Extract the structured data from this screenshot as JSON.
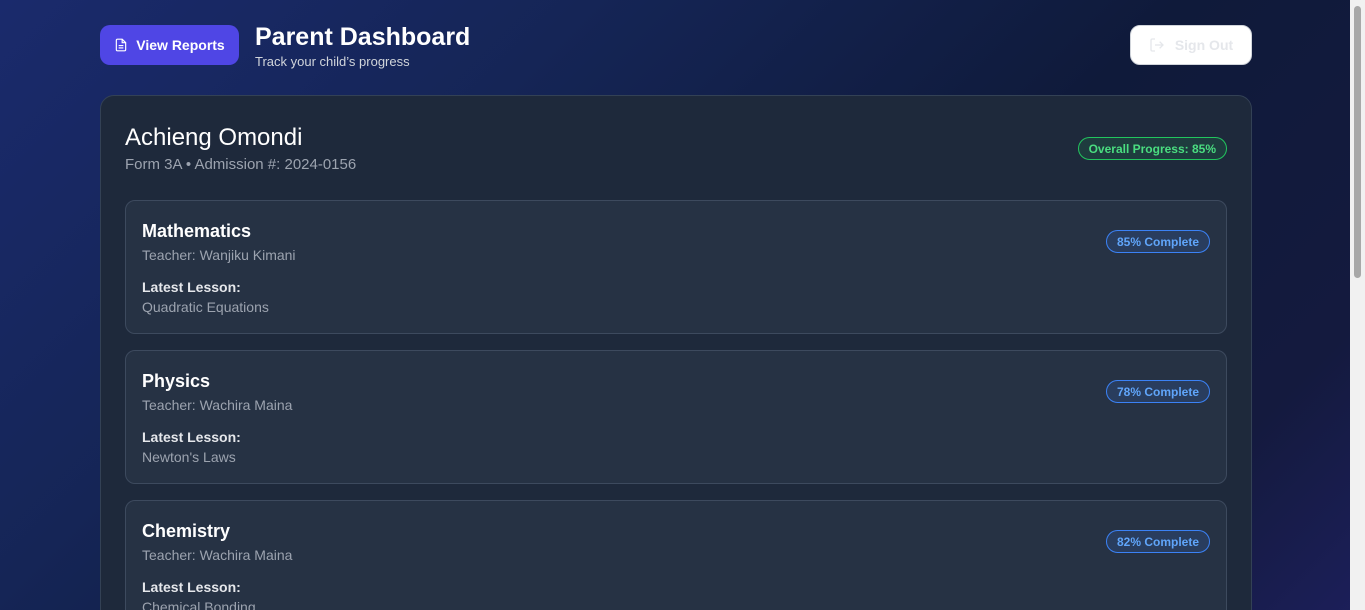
{
  "header": {
    "reports_label": "View Reports",
    "title": "Parent Dashboard",
    "subtitle": "Track your child’s progress",
    "signout_label": "Sign Out"
  },
  "student": {
    "name": "Achieng Omondi",
    "meta": "Form 3A • Admission #: 2024-0156",
    "overall": "Overall Progress: 85%"
  },
  "subjects": [
    {
      "name": "Mathematics",
      "teacher": "Teacher: Wanjiku Kimani",
      "lesson_label": "Latest Lesson:",
      "lesson": "Quadratic Equations",
      "progress": "85% Complete"
    },
    {
      "name": "Physics",
      "teacher": "Teacher: Wachira Maina",
      "lesson_label": "Latest Lesson:",
      "lesson": "Newton's Laws",
      "progress": "78% Complete"
    },
    {
      "name": "Chemistry",
      "teacher": "Teacher: Wachira Maina",
      "lesson_label": "Latest Lesson:",
      "lesson": "Chemical Bonding",
      "progress": "82% Complete"
    }
  ],
  "colors": {
    "accent": "#4f46e5",
    "success": "#22c55e",
    "info": "#3b82f6"
  }
}
